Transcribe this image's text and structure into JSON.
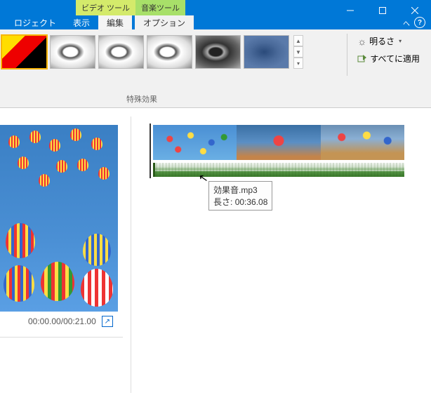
{
  "titlebar": {
    "tool_tabs": {
      "video": "ビデオ ツール",
      "music": "音楽ツール"
    }
  },
  "ribbon_tabs": {
    "project": "ロジェクト",
    "view": "表示",
    "edit": "編集",
    "option": "オプション"
  },
  "ribbon": {
    "group_label": "特殊効果",
    "brightness": "明るさ",
    "apply_all": "すべてに適用"
  },
  "preview": {
    "current_time": "00:00.00",
    "total_time": "00:21.00"
  },
  "tooltip": {
    "filename": "効果音.mp3",
    "duration_label": "長さ:",
    "duration": "00:36.08"
  }
}
